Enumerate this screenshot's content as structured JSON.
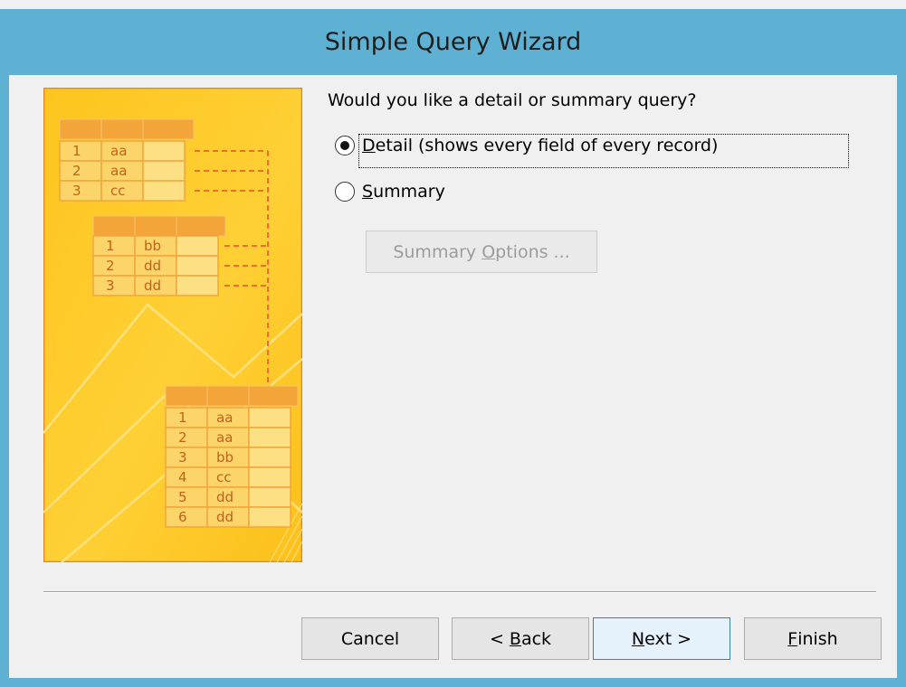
{
  "window": {
    "title": "Simple Query Wizard"
  },
  "question": "Would you like a detail or summary query?",
  "options": {
    "detail": {
      "mnemonic": "D",
      "rest": "etail (shows every field of every record)",
      "selected": true
    },
    "summary": {
      "mnemonic": "S",
      "rest": "ummary",
      "selected": false
    }
  },
  "summary_options_button": {
    "pre": "Summary ",
    "mnemonic": "O",
    "rest": "ptions ...",
    "enabled": false
  },
  "buttons": {
    "cancel": {
      "label": "Cancel"
    },
    "back": {
      "pre": "< ",
      "mnemonic": "B",
      "rest": "ack"
    },
    "next": {
      "mnemonic": "N",
      "rest": "ext >"
    },
    "finish": {
      "mnemonic": "F",
      "rest": "inish"
    }
  },
  "illustration": {
    "table1": [
      [
        "1",
        "aa"
      ],
      [
        "2",
        "aa"
      ],
      [
        "3",
        "cc"
      ]
    ],
    "table2": [
      [
        "1",
        "bb"
      ],
      [
        "2",
        "dd"
      ],
      [
        "3",
        "dd"
      ]
    ],
    "table3": [
      [
        "1",
        "aa"
      ],
      [
        "2",
        "aa"
      ],
      [
        "3",
        "bb"
      ],
      [
        "4",
        "cc"
      ],
      [
        "5",
        "dd"
      ],
      [
        "6",
        "dd"
      ]
    ]
  },
  "colors": {
    "titlebar": "#5fb1d3",
    "client_bg": "#f0f0f0",
    "illustration_bg": "#fdc51e",
    "illustration_border": "#e0822b",
    "table_header": "#f3a53a",
    "table_cell": "#fcd56a",
    "dash_line": "#ef6d2a"
  }
}
